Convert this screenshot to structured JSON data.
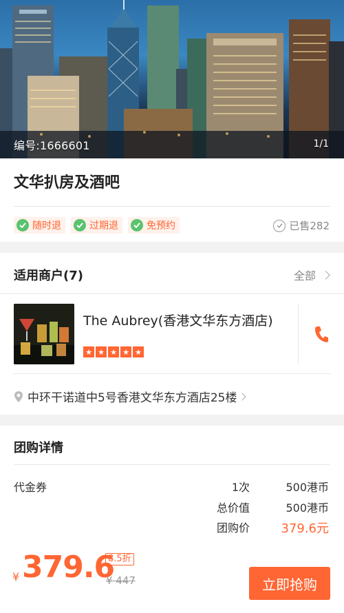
{
  "hero": {
    "code": "编号:1666601",
    "counter": "1/1"
  },
  "deal": {
    "title": "文华扒房及酒吧",
    "tags": [
      {
        "label": "随时退",
        "icon": "check-circle-icon"
      },
      {
        "label": "过期退",
        "icon": "check-circle-icon"
      },
      {
        "label": "免预约",
        "icon": "check-circle-icon"
      }
    ],
    "sold": "已售282"
  },
  "merchants": {
    "title": "适用商户(7)",
    "all_label": "全部",
    "name": "The Aubrey(香港文华东方酒店)",
    "rating_stars": 5,
    "address": "中环干诺道中5号香港文华东方酒店25楼"
  },
  "details": {
    "title": "团购详情",
    "item_label": "代金券",
    "rows": [
      {
        "label": "1次",
        "value": "500港币"
      },
      {
        "label": "总价值",
        "value": "500港币"
      },
      {
        "label": "团购价",
        "value": "379.6元"
      }
    ]
  },
  "bottom": {
    "currency": "¥",
    "price": "379.6",
    "discount": "8.5折",
    "original": "¥ 447",
    "buy_label": "立即抢购"
  },
  "colors": {
    "accent": "#ff6633",
    "check": "#5ac36f"
  }
}
